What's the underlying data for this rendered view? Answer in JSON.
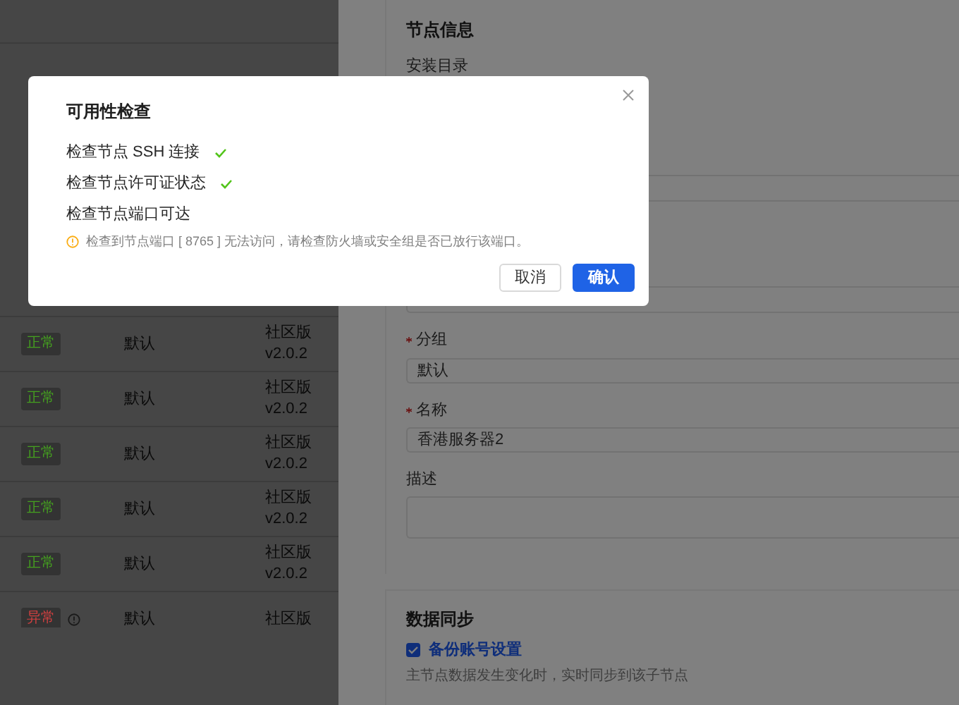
{
  "table": {
    "rows": [
      {
        "status": "正常",
        "color": "#45a020",
        "group": "默认",
        "edition": "社区版",
        "version": "v2.0.2"
      },
      {
        "status": "正常",
        "color": "#45a020",
        "group": "默认",
        "edition": "社区版",
        "version": "v2.0.2"
      },
      {
        "status": "正常",
        "color": "#45a020",
        "group": "默认",
        "edition": "社区版",
        "version": "v2.0.2"
      },
      {
        "status": "正常",
        "color": "#45a020",
        "group": "默认",
        "edition": "社区版",
        "version": "v2.0.2"
      },
      {
        "status": "正常",
        "color": "#45a020",
        "group": "默认",
        "edition": "社区版",
        "version": "v2.0.2"
      },
      {
        "status": "异常",
        "color": "#d04040",
        "info": true,
        "group": "默认",
        "edition": "社区版"
      }
    ]
  },
  "drawer": {
    "node_info": {
      "title": "节点信息",
      "install_dir_label": "安装目录",
      "fields": [
        {
          "label": "分组",
          "required": true,
          "kind": "input",
          "value": "默认"
        },
        {
          "label": "名称",
          "required": true,
          "kind": "input",
          "value": "香港服务器2"
        },
        {
          "label": "描述",
          "required": false,
          "kind": "textarea"
        }
      ]
    },
    "sync": {
      "title": "数据同步",
      "checkbox": {
        "label": "备份账号设置",
        "checked": true
      },
      "help": "主节点数据发生变化时，实时同步到该子节点"
    }
  },
  "dialog": {
    "title": "可用性检查",
    "checks": [
      {
        "label": "检查节点 SSH 连接",
        "passed": true
      },
      {
        "label": "检查节点许可证状态",
        "passed": true
      },
      {
        "label": "检查节点端口可达",
        "passed": false,
        "message": "检查到节点端口 [ 8765 ] 无法访问，请检查防火墙或安全组是否已放行该端口。"
      }
    ],
    "buttons": [
      {
        "label": "取消",
        "kind": "default"
      },
      {
        "label": "确认",
        "kind": "primary"
      }
    ]
  }
}
